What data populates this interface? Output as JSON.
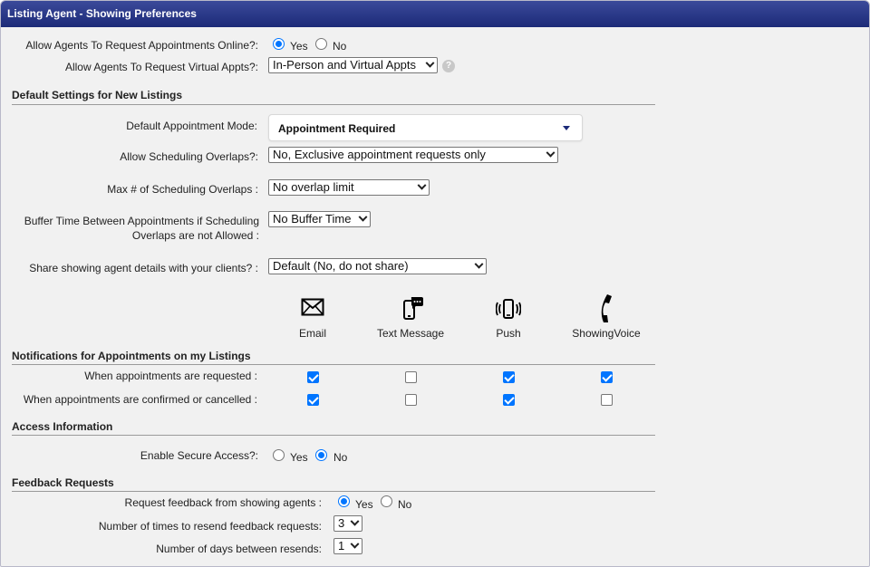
{
  "header": {
    "title": "Listing Agent - Showing Preferences"
  },
  "online_requests": {
    "label": "Allow Agents To Request Appointments Online?:",
    "yes": "Yes",
    "no": "No",
    "selected": "Yes"
  },
  "virtual_appts": {
    "label": "Allow Agents To Request Virtual Appts?:",
    "value": "In-Person and Virtual Appts",
    "help": "?"
  },
  "defaults": {
    "title": "Default Settings for New Listings",
    "appointment_mode": {
      "label": "Default Appointment Mode:",
      "value": "Appointment Required"
    },
    "overlaps": {
      "label": "Allow Scheduling Overlaps?:",
      "value": "No, Exclusive appointment requests only"
    },
    "max_overlaps": {
      "label": "Max # of Scheduling Overlaps :",
      "value": "No overlap limit"
    },
    "buffer": {
      "label": "Buffer Time Between Appointments if Scheduling Overlaps are not Allowed :",
      "value": "No Buffer Time"
    },
    "share_details": {
      "label": "Share showing agent details with your clients? :",
      "value": "Default (No, do not share)"
    }
  },
  "channels": [
    "Email",
    "Text Message",
    "Push",
    "ShowingVoice"
  ],
  "notifications": {
    "title": "Notifications for Appointments on my Listings",
    "rows": [
      {
        "label": "When appointments are requested :",
        "checks": [
          true,
          false,
          true,
          true
        ]
      },
      {
        "label": "When appointments are confirmed or cancelled :",
        "checks": [
          true,
          false,
          true,
          false
        ]
      }
    ]
  },
  "access": {
    "title": "Access Information",
    "secure": {
      "label": "Enable Secure Access?:",
      "yes": "Yes",
      "no": "No",
      "selected": "No"
    }
  },
  "feedback": {
    "title": "Feedback Requests",
    "request": {
      "label": "Request feedback from showing agents :",
      "yes": "Yes",
      "no": "No",
      "selected": "Yes"
    },
    "resend_times": {
      "label": "Number of times to resend feedback requests:",
      "value": "3"
    },
    "resend_days": {
      "label": "Number of days between resends:",
      "value": "1"
    }
  },
  "colors": {
    "header_top": "#3b4a9a",
    "header_bottom": "#1c2a78",
    "accent": "#0075ff"
  }
}
